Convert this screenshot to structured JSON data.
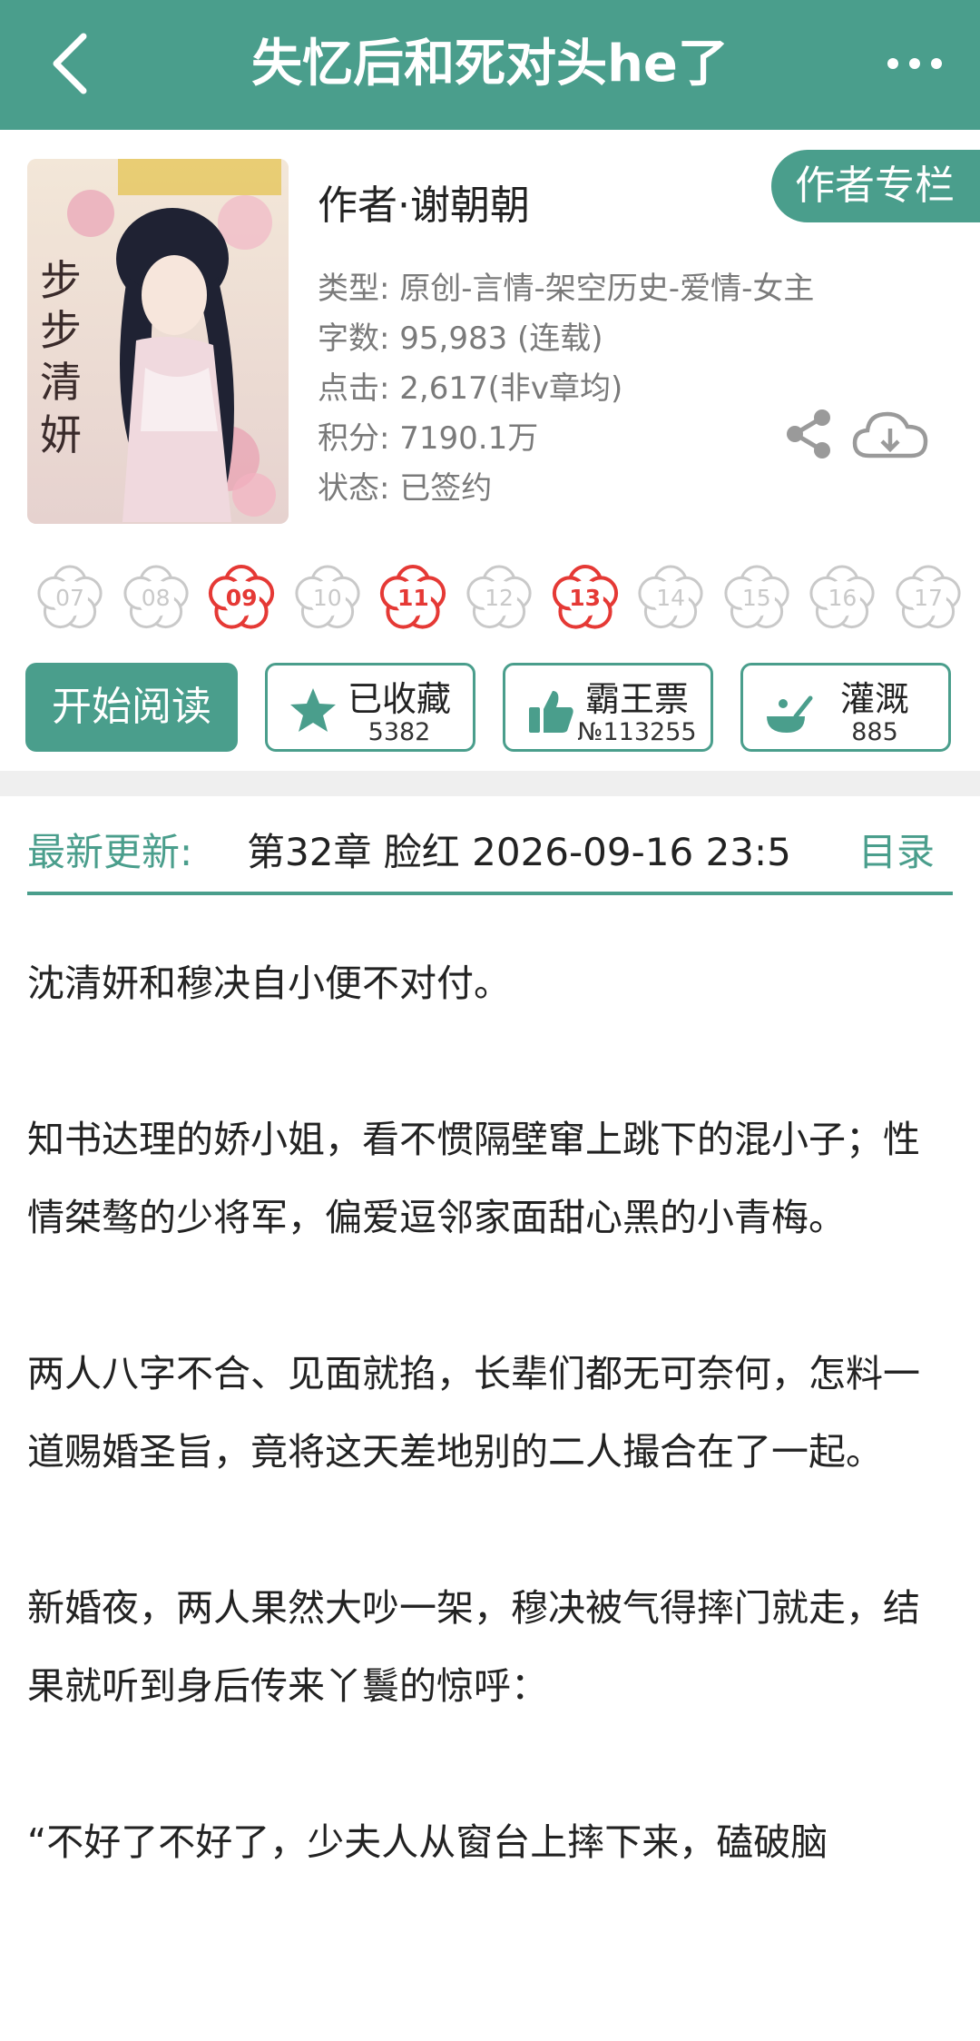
{
  "header": {
    "title": "失忆后和死对头he了",
    "back_icon": "chevron-left-icon",
    "more_icon": "more-dots-icon",
    "bg_color": "#4a9e8c"
  },
  "book": {
    "cover_icon": "book-cover-image",
    "cover_text": "步步清妍",
    "author": "作者·谢朝朝",
    "author_column_label": "作者专栏",
    "genre": "类型: 原创-言情-架空历史-爱情-女主",
    "word_count": "字数: 95,983 (连载)",
    "clicks": "点击: 2,617(非v章均)",
    "score": "积分: 7190.1万",
    "status": "状态: 已签约",
    "share_icon": "share-icon",
    "download_icon": "cloud-download-icon"
  },
  "flowers": [
    {
      "num": "07",
      "active": false
    },
    {
      "num": "08",
      "active": false
    },
    {
      "num": "09",
      "active": true
    },
    {
      "num": "10",
      "active": false
    },
    {
      "num": "11",
      "active": true
    },
    {
      "num": "12",
      "active": false
    },
    {
      "num": "13",
      "active": true
    },
    {
      "num": "14",
      "active": false
    },
    {
      "num": "15",
      "active": false
    },
    {
      "num": "16",
      "active": false
    },
    {
      "num": "17",
      "active": false
    }
  ],
  "actions": {
    "read_label": "开始阅读",
    "favorite": {
      "label": "已收藏",
      "count": "5382",
      "icon": "star-icon"
    },
    "ticket": {
      "label": "霸王票",
      "count": "№113255",
      "icon": "thumbs-up-icon"
    },
    "water": {
      "label": "灌溉",
      "count": "885",
      "icon": "watering-icon"
    }
  },
  "update": {
    "label": "最新更新:",
    "text": "第32章  脸红  2026-09-16 23:5",
    "toc_label": "目录"
  },
  "synopsis": [
    "沈清妍和穆决自小便不对付。",
    "知书达理的娇小姐，看不惯隔壁窜上跳下的混小子；性情桀骜的少将军，偏爱逗邻家面甜心黑的小青梅。",
    "两人八字不合、见面就掐，长辈们都无可奈何，怎料一道赐婚圣旨，竟将这天差地别的二人撮合在了一起。",
    "新婚夜，两人果然大吵一架，穆决被气得摔门就走，结果就听到身后传来丫鬟的惊呼：",
    "“不好了不好了，少夫人从窗台上摔下来，磕破脑"
  ],
  "colors": {
    "accent": "#4a9e8c",
    "flower_active": "#e53935",
    "flower_inactive": "#c9c9c9"
  }
}
